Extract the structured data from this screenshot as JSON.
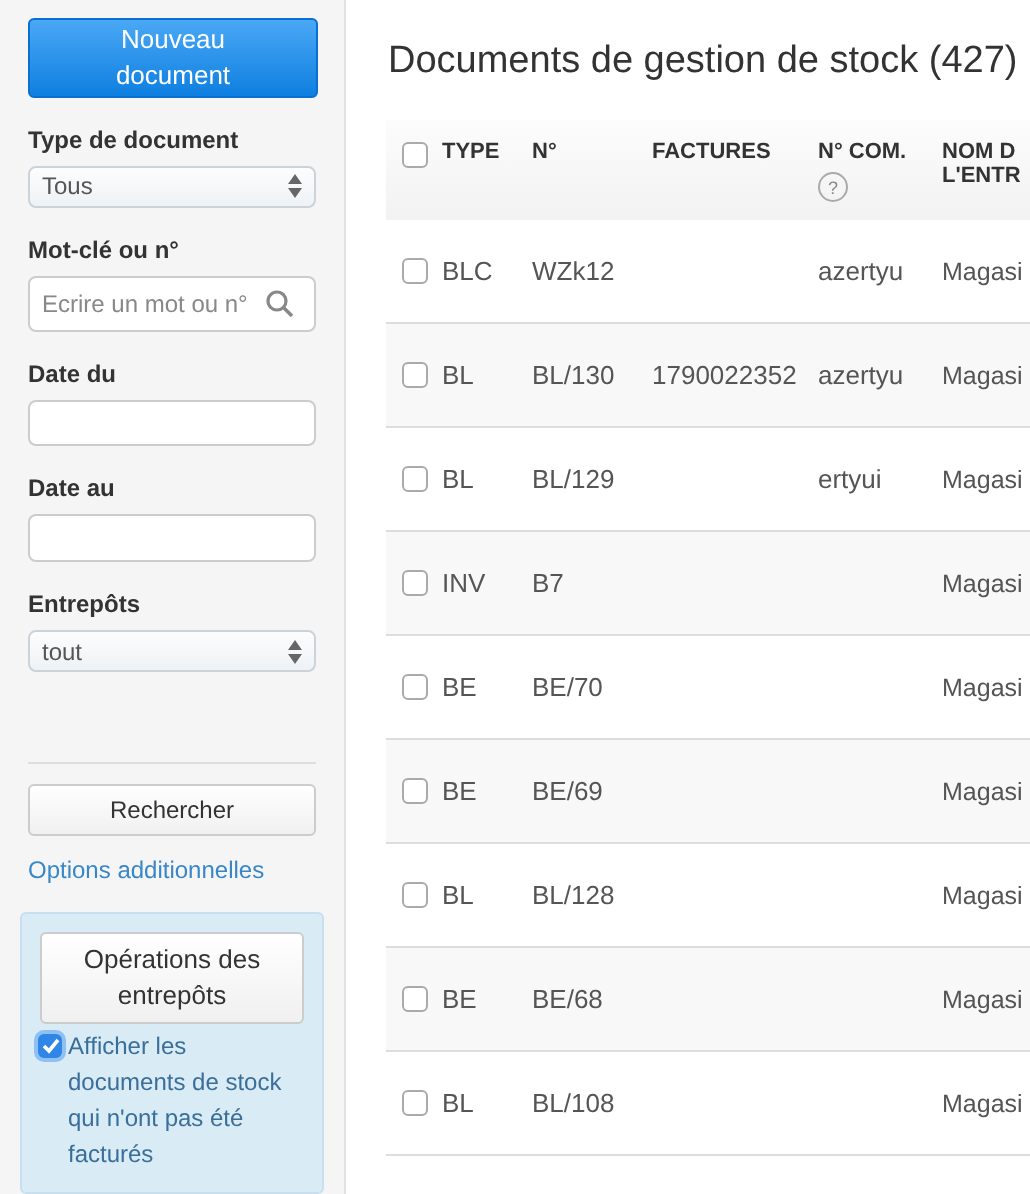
{
  "sidebar": {
    "new_button": "Nouveau document",
    "filters": [
      {
        "kind": "select",
        "label": "Type de document",
        "value": "Tous"
      },
      {
        "kind": "search",
        "label": "Mot-clé ou n°",
        "placeholder": "Ecrire un mot ou n°"
      },
      {
        "kind": "text",
        "label": "Date du"
      },
      {
        "kind": "text",
        "label": "Date au"
      },
      {
        "kind": "select",
        "label": "Entrepôts",
        "value": "tout"
      }
    ],
    "search_button": "Rechercher",
    "options_link": "Options additionnelles",
    "panel": {
      "button": "Opérations des entrepôts",
      "checkbox": {
        "label": "Afficher les documents de stock qui n'ont pas été facturés",
        "checked": true
      }
    }
  },
  "main": {
    "title": "Documents de gestion de stock (427)",
    "table": {
      "select_all": false,
      "columns": [
        {
          "label": "TYPE"
        },
        {
          "label": "N°"
        },
        {
          "label": "FACTURES"
        },
        {
          "label": "N° COM.",
          "help": "?"
        },
        {
          "label": "NOM D L'ENTR"
        }
      ],
      "rows": [
        {
          "checked": false,
          "cells": [
            "BLC",
            "WZk12",
            "",
            "azertyu",
            "Magasi"
          ]
        },
        {
          "checked": false,
          "cells": [
            "BL",
            "BL/130",
            "1790022352",
            "azertyu",
            "Magasi"
          ]
        },
        {
          "checked": false,
          "cells": [
            "BL",
            "BL/129",
            "",
            "ertyui",
            "Magasi"
          ]
        },
        {
          "checked": false,
          "cells": [
            "INV",
            "B7",
            "",
            "",
            "Magasi"
          ]
        },
        {
          "checked": false,
          "cells": [
            "BE",
            "BE/70",
            "",
            "",
            "Magasi"
          ]
        },
        {
          "checked": false,
          "cells": [
            "BE",
            "BE/69",
            "",
            "",
            "Magasi"
          ]
        },
        {
          "checked": false,
          "cells": [
            "BL",
            "BL/128",
            "",
            "",
            "Magasi"
          ]
        },
        {
          "checked": false,
          "cells": [
            "BE",
            "BE/68",
            "",
            "",
            "Magasi"
          ]
        },
        {
          "checked": false,
          "cells": [
            "BL",
            "BL/108",
            "",
            "",
            "Magasi"
          ]
        }
      ]
    }
  }
}
